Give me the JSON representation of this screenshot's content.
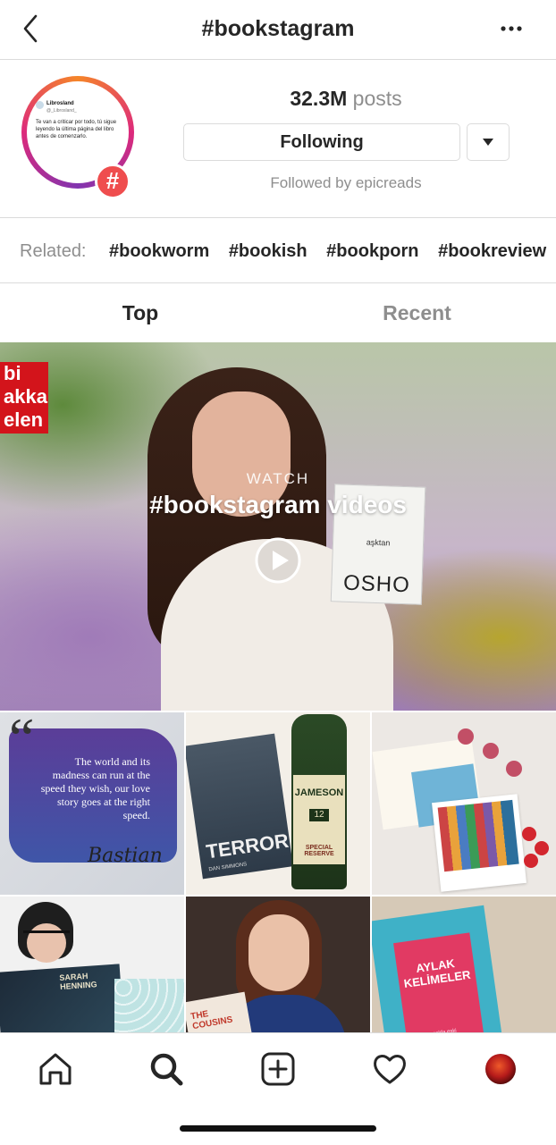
{
  "header": {
    "title": "#bookstagram",
    "back_icon": "chevron-left-icon",
    "more_icon": "more-horizontal-icon"
  },
  "profile": {
    "avatar": {
      "account_name": "Librosland",
      "account_handle": "@_Librosland_",
      "quote": "Te van a criticar por todo, tú sigue leyendo la última página del libro antes de comenzarlo.",
      "badge": "#"
    },
    "posts_count": "32.3M",
    "posts_label": "posts",
    "follow_button": "Following",
    "dropdown_icon": "caret-down-icon",
    "followed_by": "Followed by epicreads"
  },
  "related": {
    "label": "Related:",
    "tags": [
      "#bookworm",
      "#bookish",
      "#bookporn",
      "#bookreview"
    ]
  },
  "tabs": {
    "top": "Top",
    "recent": "Recent",
    "active": "Top"
  },
  "video": {
    "overlay_red": [
      "bi",
      "akka",
      "elen"
    ],
    "book_title": "OSHO",
    "book_subtitle": "aşktan",
    "watch_label": "WATCH",
    "watch_title": "#bookstagram videos",
    "play_icon": "play-circle-icon"
  },
  "grid": {
    "post1": {
      "quote": "The world and its madness can run at the speed they wish, our love story goes at the right speed.",
      "signature": "Bastian"
    },
    "post2": {
      "book_title": "TERROR",
      "book_author": "DAN SIMMONS",
      "bottle_brand": "JAMESON",
      "bottle_age": "12",
      "bottle_text": "SPECIAL RESERVE"
    },
    "post4": {
      "book_author": "SARAH HENNING"
    },
    "post5": {
      "book_title": "THE COUSINS"
    },
    "post6": {
      "book_title": "AYLAK KELİMELER",
      "book_author": "selda eski"
    }
  },
  "nav": [
    "home-icon",
    "search-icon",
    "new-post-icon",
    "heart-icon",
    "profile-avatar"
  ],
  "colors": {
    "text": "#262626",
    "secondary": "#8e8e8e",
    "border": "#dbdbdb",
    "badge": "#ef4d4e"
  }
}
